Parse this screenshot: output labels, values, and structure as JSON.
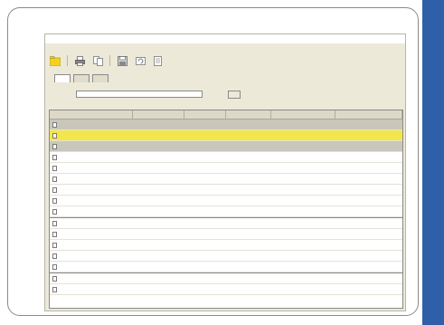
{
  "colors": {
    "accent_stripe": "#2f5fa8",
    "selected_row": "#f2e64a",
    "band_row": "#c9c7bc",
    "window_bg": "#ece9d8"
  },
  "window": {
    "title": ""
  },
  "menubar": {
    "items": [
      "",
      "",
      ""
    ]
  },
  "toolbar": {
    "icons": [
      "folder-icon",
      "print-icon",
      "copy-icon",
      "save-icon",
      "refresh-icon",
      "export-icon"
    ]
  },
  "tabs": {
    "label": "",
    "items": [
      {
        "label": ""
      },
      {
        "label": ""
      },
      {
        "label": ""
      }
    ]
  },
  "filter": {
    "label": "",
    "value": "",
    "button_label": ""
  },
  "count_text": "",
  "grid": {
    "columns": [
      "",
      "",
      "",
      "",
      "",
      ""
    ],
    "rows": [
      {
        "style": "band",
        "cells": [
          "",
          "",
          "",
          "",
          "",
          ""
        ]
      },
      {
        "style": "selected",
        "cells": [
          "",
          "",
          "",
          "",
          "",
          ""
        ]
      },
      {
        "style": "band",
        "cells": [
          "",
          "",
          "",
          "",
          "",
          ""
        ]
      },
      {
        "style": "white",
        "cells": [
          "",
          "",
          "",
          "",
          "",
          ""
        ]
      },
      {
        "style": "white",
        "cells": [
          "",
          "",
          "",
          "",
          "",
          ""
        ]
      },
      {
        "style": "white",
        "cells": [
          "",
          "",
          "",
          "",
          "",
          ""
        ]
      },
      {
        "style": "white",
        "cells": [
          "",
          "",
          "",
          "",
          "",
          ""
        ]
      },
      {
        "style": "white",
        "cells": [
          "",
          "",
          "",
          "",
          "",
          ""
        ]
      },
      {
        "style": "white",
        "cells": [
          "",
          "",
          "",
          "",
          "",
          ""
        ]
      },
      {
        "style": "white",
        "cells": [
          "",
          "",
          "",
          "",
          "",
          ""
        ]
      },
      {
        "style": "white",
        "cells": [
          "",
          "",
          "",
          "",
          "",
          ""
        ]
      },
      {
        "style": "white",
        "cells": [
          "",
          "",
          "",
          "",
          "",
          ""
        ]
      },
      {
        "style": "white",
        "cells": [
          "",
          "",
          "",
          "",
          "",
          ""
        ]
      },
      {
        "style": "white",
        "cells": [
          "",
          "",
          "",
          "",
          "",
          ""
        ]
      },
      {
        "style": "white",
        "cells": [
          "",
          "",
          "",
          "",
          "",
          ""
        ]
      },
      {
        "style": "white",
        "cells": [
          "",
          "",
          "",
          "",
          "",
          ""
        ]
      }
    ]
  }
}
